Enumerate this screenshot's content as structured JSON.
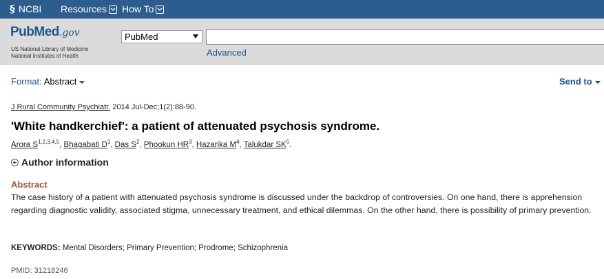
{
  "ncbi_bar": {
    "logo_text": "NCBI",
    "resources_label": "Resources",
    "howto_label": "How To"
  },
  "pubmed_header": {
    "logo_pub": "Pub",
    "logo_med": "Med",
    "logo_gov": ".gov",
    "subtitle_line1": "US National Library of Medicine",
    "subtitle_line2": "National Institutes of Health",
    "database_selected": "PubMed",
    "search_value": "",
    "advanced_label": "Advanced"
  },
  "toolbar": {
    "format_label": "Format",
    "format_value": "Abstract",
    "send_to_label": "Send to"
  },
  "article": {
    "journal": "J Rural Community Psychiatr.",
    "citation_rest": "2014 Jul-Dec;1(2):88-90.",
    "title": "'White handkerchief': a patient of attenuated psychosis syndrome.",
    "authors": [
      {
        "name": "Arora S",
        "aff": "1,2,3,4,5"
      },
      {
        "name": "Bhagabati D",
        "aff": "1"
      },
      {
        "name": "Das S",
        "aff": "2"
      },
      {
        "name": "Phookun HR",
        "aff": "3"
      },
      {
        "name": "Hazarika M",
        "aff": "4"
      },
      {
        "name": "Talukdar SK",
        "aff": "5"
      }
    ],
    "author_info_label": "Author information",
    "abstract_heading": "Abstract",
    "abstract_text": "The case history of a patient with attenuated psychosis syndrome is discussed under the backdrop of controversies. On one hand, there is apprehension regarding diagnostic validity, associated stigma, unnecessary treatment, and ethical dilemmas. On the other hand, there is possibility of primary prevention.",
    "keywords_label": "KEYWORDS:",
    "keywords": "Mental Disorders; Primary Prevention; Prodrome; Schizophrenia",
    "pmid_label": "PMID:",
    "pmid": "31218246"
  },
  "colors": {
    "ncbi_bar": "#2d5d8f",
    "link_blue": "#20558a",
    "abstract_heading": "#985735"
  }
}
